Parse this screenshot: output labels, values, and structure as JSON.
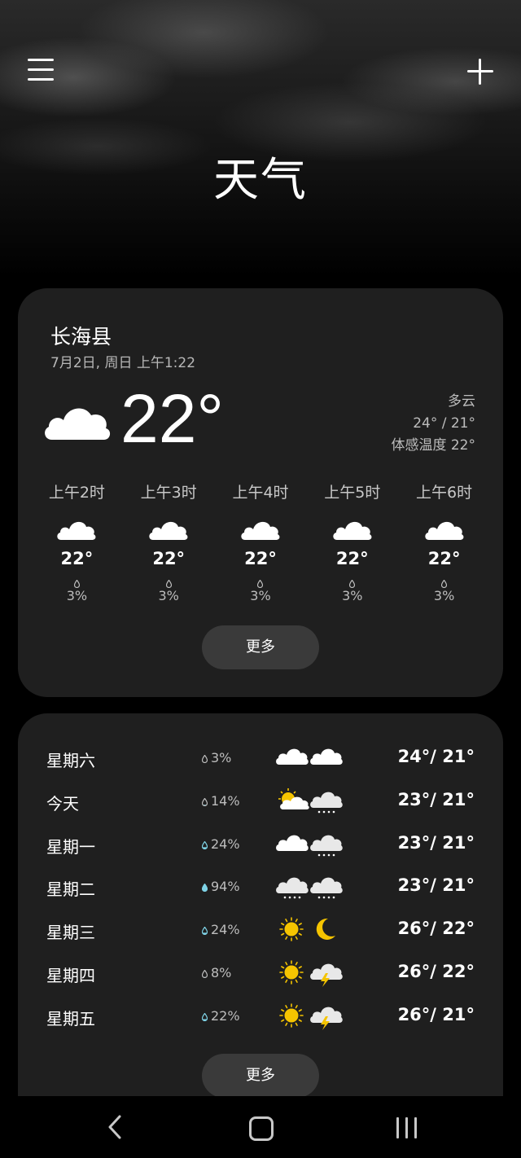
{
  "header": {
    "title": "天气",
    "menu_icon": "hamburger-menu-icon",
    "add_icon": "plus-icon"
  },
  "current": {
    "location": "长海县",
    "datetime": "7月2日, 周日 上午1:22",
    "temperature": "22°",
    "condition": "多云",
    "high_low": "24° / 21°",
    "feels_like": "体感温度 22°",
    "icon": "cloud-icon"
  },
  "hourly": [
    {
      "time": "上午2时",
      "icon": "cloud-icon",
      "temp": "22°",
      "rain": "3%"
    },
    {
      "time": "上午3时",
      "icon": "cloud-icon",
      "temp": "22°",
      "rain": "3%"
    },
    {
      "time": "上午4时",
      "icon": "cloud-icon",
      "temp": "22°",
      "rain": "3%"
    },
    {
      "time": "上午5时",
      "icon": "cloud-icon",
      "temp": "22°",
      "rain": "3%"
    },
    {
      "time": "上午6时",
      "icon": "cloud-icon",
      "temp": "22°",
      "rain": "3%"
    }
  ],
  "hourly_more_label": "更多",
  "daily": [
    {
      "day": "星期六",
      "rain": "3%",
      "rain_drop_level": 0.03,
      "day_icon": "cloud-icon",
      "night_icon": "cloud-icon",
      "range": "24°/ 21°"
    },
    {
      "day": "今天",
      "rain": "14%",
      "rain_drop_level": 0.14,
      "day_icon": "partly-cloudy-icon",
      "night_icon": "rain-cloud-icon",
      "range": "23°/ 21°"
    },
    {
      "day": "星期一",
      "rain": "24%",
      "rain_drop_level": 0.24,
      "day_icon": "cloud-icon",
      "night_icon": "rain-cloud-icon",
      "range": "23°/ 21°"
    },
    {
      "day": "星期二",
      "rain": "94%",
      "rain_drop_level": 0.94,
      "day_icon": "rain-cloud-icon",
      "night_icon": "rain-cloud-icon",
      "range": "23°/ 21°"
    },
    {
      "day": "星期三",
      "rain": "24%",
      "rain_drop_level": 0.24,
      "day_icon": "sun-icon",
      "night_icon": "moon-icon",
      "range": "26°/ 22°"
    },
    {
      "day": "星期四",
      "rain": "8%",
      "rain_drop_level": 0.08,
      "day_icon": "sun-icon",
      "night_icon": "thunderstorm-icon",
      "range": "26°/ 22°"
    },
    {
      "day": "星期五",
      "rain": "22%",
      "rain_drop_level": 0.22,
      "day_icon": "sun-icon",
      "night_icon": "thunderstorm-icon",
      "range": "26°/ 21°"
    }
  ],
  "daily_more_label": "更多",
  "colors": {
    "background": "#000000",
    "card": "#1f1f1f",
    "button": "#3a3a3a",
    "sun": "#f5c400",
    "drop_accent": "#7fd3e6"
  },
  "navbar": {
    "back_icon": "back-chevron-icon",
    "home_icon": "home-icon",
    "recents_icon": "recent-apps-icon"
  }
}
